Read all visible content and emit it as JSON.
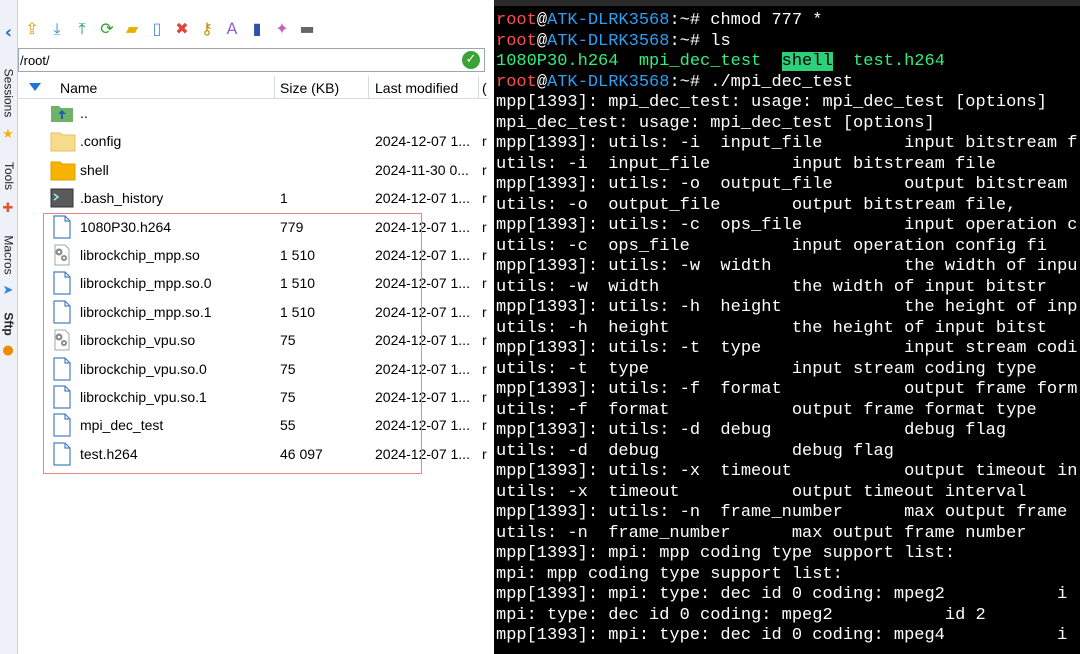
{
  "sidebar": {
    "tabs": [
      "Sessions",
      "Tools",
      "Macros",
      "Sftp"
    ]
  },
  "toolbar": {
    "buttons": [
      {
        "name": "upload-folder",
        "glyph": "⇪",
        "color": "#e0a000"
      },
      {
        "name": "download",
        "glyph": "⤓",
        "color": "#2e8bd6"
      },
      {
        "name": "upload",
        "glyph": "⤒",
        "color": "#1a9e57"
      },
      {
        "name": "refresh",
        "glyph": "⟳",
        "color": "#2aa52a"
      },
      {
        "name": "new-folder",
        "glyph": "▰",
        "color": "#e8b000"
      },
      {
        "name": "new-file",
        "glyph": "▯",
        "color": "#4a90e2"
      },
      {
        "name": "delete",
        "glyph": "✖",
        "color": "#e0443b"
      },
      {
        "name": "permissions",
        "glyph": "⚷",
        "color": "#c88a00"
      },
      {
        "name": "rename",
        "glyph": "A",
        "color": "#8d63c7"
      },
      {
        "name": "terminal-follow",
        "glyph": "▮",
        "color": "#2f4fa8"
      },
      {
        "name": "wand",
        "glyph": "✦",
        "color": "#c060c0"
      },
      {
        "name": "console",
        "glyph": "▬",
        "color": "#666666"
      }
    ]
  },
  "path": {
    "value": "/root/"
  },
  "columns": {
    "name": "Name",
    "size": "Size (KB)",
    "modified": "Last modified",
    "extra": "("
  },
  "files": [
    {
      "name": "..",
      "size": "",
      "modified": "",
      "icon": "up-folder-icon",
      "extra": ""
    },
    {
      "name": ".config",
      "size": "",
      "modified": "2024-12-07 1...",
      "icon": "folder-light-icon",
      "extra": "r"
    },
    {
      "name": "shell",
      "size": "",
      "modified": "2024-11-30 0...",
      "icon": "folder-icon",
      "extra": "r"
    },
    {
      "name": ".bash_history",
      "size": "1",
      "modified": "2024-12-07 1...",
      "icon": "terminal-file-icon",
      "extra": "r"
    },
    {
      "name": "1080P30.h264",
      "size": "779",
      "modified": "2024-12-07 1...",
      "icon": "file-icon",
      "extra": "r"
    },
    {
      "name": "librockchip_mpp.so",
      "size": "1 510",
      "modified": "2024-12-07 1...",
      "icon": "library-file-icon",
      "extra": "r"
    },
    {
      "name": "librockchip_mpp.so.0",
      "size": "1 510",
      "modified": "2024-12-07 1...",
      "icon": "file-icon",
      "extra": "r"
    },
    {
      "name": "librockchip_mpp.so.1",
      "size": "1 510",
      "modified": "2024-12-07 1...",
      "icon": "file-icon",
      "extra": "r"
    },
    {
      "name": "librockchip_vpu.so",
      "size": "75",
      "modified": "2024-12-07 1...",
      "icon": "library-file-icon",
      "extra": "r"
    },
    {
      "name": "librockchip_vpu.so.0",
      "size": "75",
      "modified": "2024-12-07 1...",
      "icon": "file-icon",
      "extra": "r"
    },
    {
      "name": "librockchip_vpu.so.1",
      "size": "75",
      "modified": "2024-12-07 1...",
      "icon": "file-icon",
      "extra": "r"
    },
    {
      "name": "mpi_dec_test",
      "size": "55",
      "modified": "2024-12-07 1...",
      "icon": "file-icon",
      "extra": "r"
    },
    {
      "name": "test.h264",
      "size": "46 097",
      "modified": "2024-12-07 1...",
      "icon": "file-icon",
      "extra": "r"
    }
  ],
  "terminal": {
    "prompt_user": "root",
    "prompt_at": "@",
    "prompt_host": "ATK-DLRK3568",
    "prompt_tail": ":~# ",
    "commands": [
      "chmod 777 *",
      "ls",
      "./mpi_dec_test"
    ],
    "ls_output": [
      "1080P30.h264",
      "mpi_dec_test",
      "shell",
      "test.h264"
    ],
    "output_lines": [
      "mpp[1393]: mpi_dec_test: usage: mpi_dec_test [options]",
      "mpi_dec_test: usage: mpi_dec_test [options]",
      "mpp[1393]: utils: -i  input_file        input bitstream f",
      "utils: -i  input_file        input bitstream file",
      "mpp[1393]: utils: -o  output_file       output bitstream ",
      "utils: -o  output_file       output bitstream file,",
      "mpp[1393]: utils: -c  ops_file          input operation c",
      "utils: -c  ops_file          input operation config fi",
      "mpp[1393]: utils: -w  width             the width of inpu",
      "utils: -w  width             the width of input bitstr",
      "mpp[1393]: utils: -h  height            the height of inp",
      "utils: -h  height            the height of input bitst",
      "mpp[1393]: utils: -t  type              input stream codi",
      "utils: -t  type              input stream coding type ",
      "mpp[1393]: utils: -f  format            output frame form",
      "utils: -f  format            output frame format type ",
      "mpp[1393]: utils: -d  debug             debug flag",
      "utils: -d  debug             debug flag",
      "mpp[1393]: utils: -x  timeout           output timeout in",
      "utils: -x  timeout           output timeout interval ",
      "mpp[1393]: utils: -n  frame_number      max output frame ",
      "utils: -n  frame_number      max output frame number ",
      "mpp[1393]: mpi: mpp coding type support list:",
      "mpi: mpp coding type support list:",
      "mpp[1393]: mpi: type: dec id 0 coding: mpeg2           i",
      "mpi: type: dec id 0 coding: mpeg2           id 2",
      "mpp[1393]: mpi: type: dec id 0 coding: mpeg4           i"
    ]
  },
  "colors": {
    "prompt_user": "#ff4d4d",
    "prompt_host": "#2c9ff3",
    "ls_text": "#2ef07c",
    "ls_highlight_bg": "#2dd07a",
    "selection_border": "#e6848a"
  }
}
